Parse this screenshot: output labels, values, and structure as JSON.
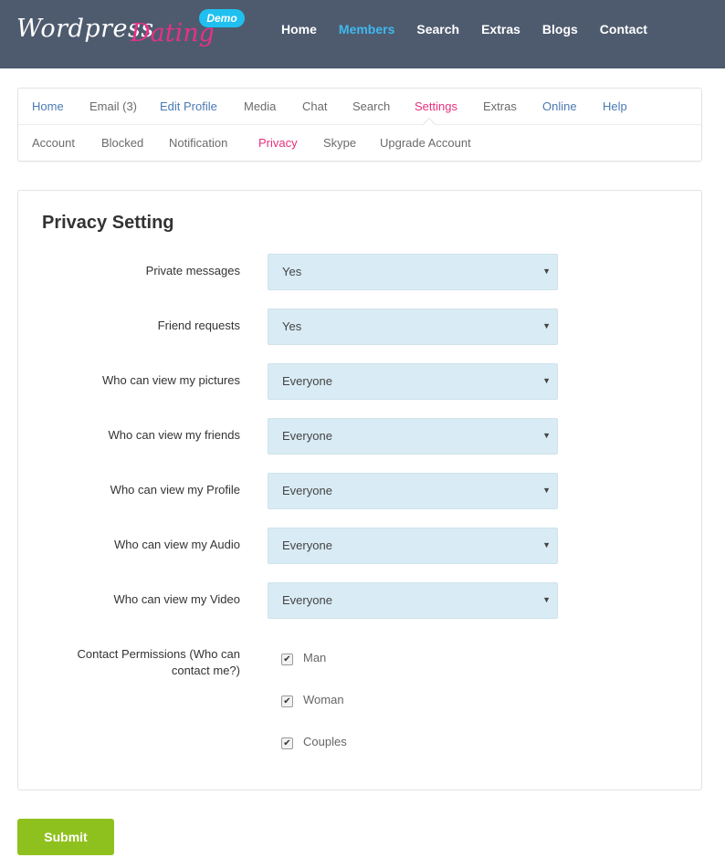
{
  "brand": {
    "word1": "Wordpress",
    "word2": "Dating",
    "badge": "Demo"
  },
  "main_nav": [
    {
      "label": "Home",
      "active": false
    },
    {
      "label": "Members",
      "active": true
    },
    {
      "label": "Search",
      "active": false
    },
    {
      "label": "Extras",
      "active": false
    },
    {
      "label": "Blogs",
      "active": false
    },
    {
      "label": "Contact",
      "active": false
    }
  ],
  "sub_nav": [
    "Home",
    "Email (3)",
    "Edit Profile",
    "Media",
    "Chat",
    "Search",
    "Settings",
    "Extras",
    "Online",
    "Help"
  ],
  "settings_nav": [
    "Account",
    "Blocked",
    "Notification",
    "Privacy",
    "Skype",
    "Upgrade Account"
  ],
  "panel": {
    "title": "Privacy Setting"
  },
  "fields": [
    {
      "label": "Private messages",
      "value": "Yes"
    },
    {
      "label": "Friend requests",
      "value": "Yes"
    },
    {
      "label": "Who can view my pictures",
      "value": "Everyone"
    },
    {
      "label": "Who can view my friends",
      "value": "Everyone"
    },
    {
      "label": "Who can view my Profile",
      "value": "Everyone"
    },
    {
      "label": "Who can view my Audio",
      "value": "Everyone"
    },
    {
      "label": "Who can view my Video",
      "value": "Everyone"
    }
  ],
  "contact": {
    "label_line1": "Contact Permissions (Who can",
    "label_line2": "contact me?)",
    "options": [
      {
        "label": "Man",
        "checked": true
      },
      {
        "label": "Woman",
        "checked": true
      },
      {
        "label": "Couples",
        "checked": true
      }
    ]
  },
  "submit_label": "Submit",
  "colors": {
    "header_bg": "#4e5b6e",
    "accent_blue": "#3fb9ef",
    "accent_pink": "#e8307c",
    "select_bg": "#d9ebf4",
    "submit_bg": "#8fc11e"
  },
  "icons": {
    "select_arrow": "triangle-down-icon",
    "checkbox": "checkmark-icon"
  }
}
